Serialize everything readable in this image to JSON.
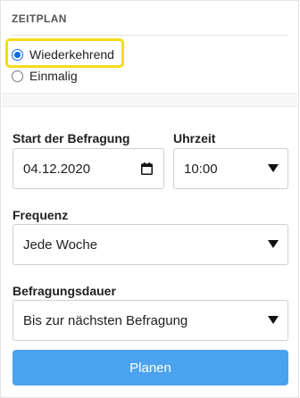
{
  "schedule": {
    "header": "ZEITPLAN",
    "options": [
      {
        "label": "Wiederkehrend",
        "checked": true
      },
      {
        "label": "Einmalig",
        "checked": false
      }
    ]
  },
  "form": {
    "start_label": "Start der Befragung",
    "start_value": "04.12.2020",
    "time_label": "Uhrzeit",
    "time_value": "10:00",
    "frequency_label": "Frequenz",
    "frequency_value": "Jede Woche",
    "duration_label": "Befragungsdauer",
    "duration_value": "Bis zur nächsten Befragung"
  },
  "actions": {
    "submit_label": "Planen"
  },
  "colors": {
    "highlight": "#f2dc1e",
    "primary_button": "#4ba3ef",
    "radio_accent": "#0a6cf0"
  }
}
